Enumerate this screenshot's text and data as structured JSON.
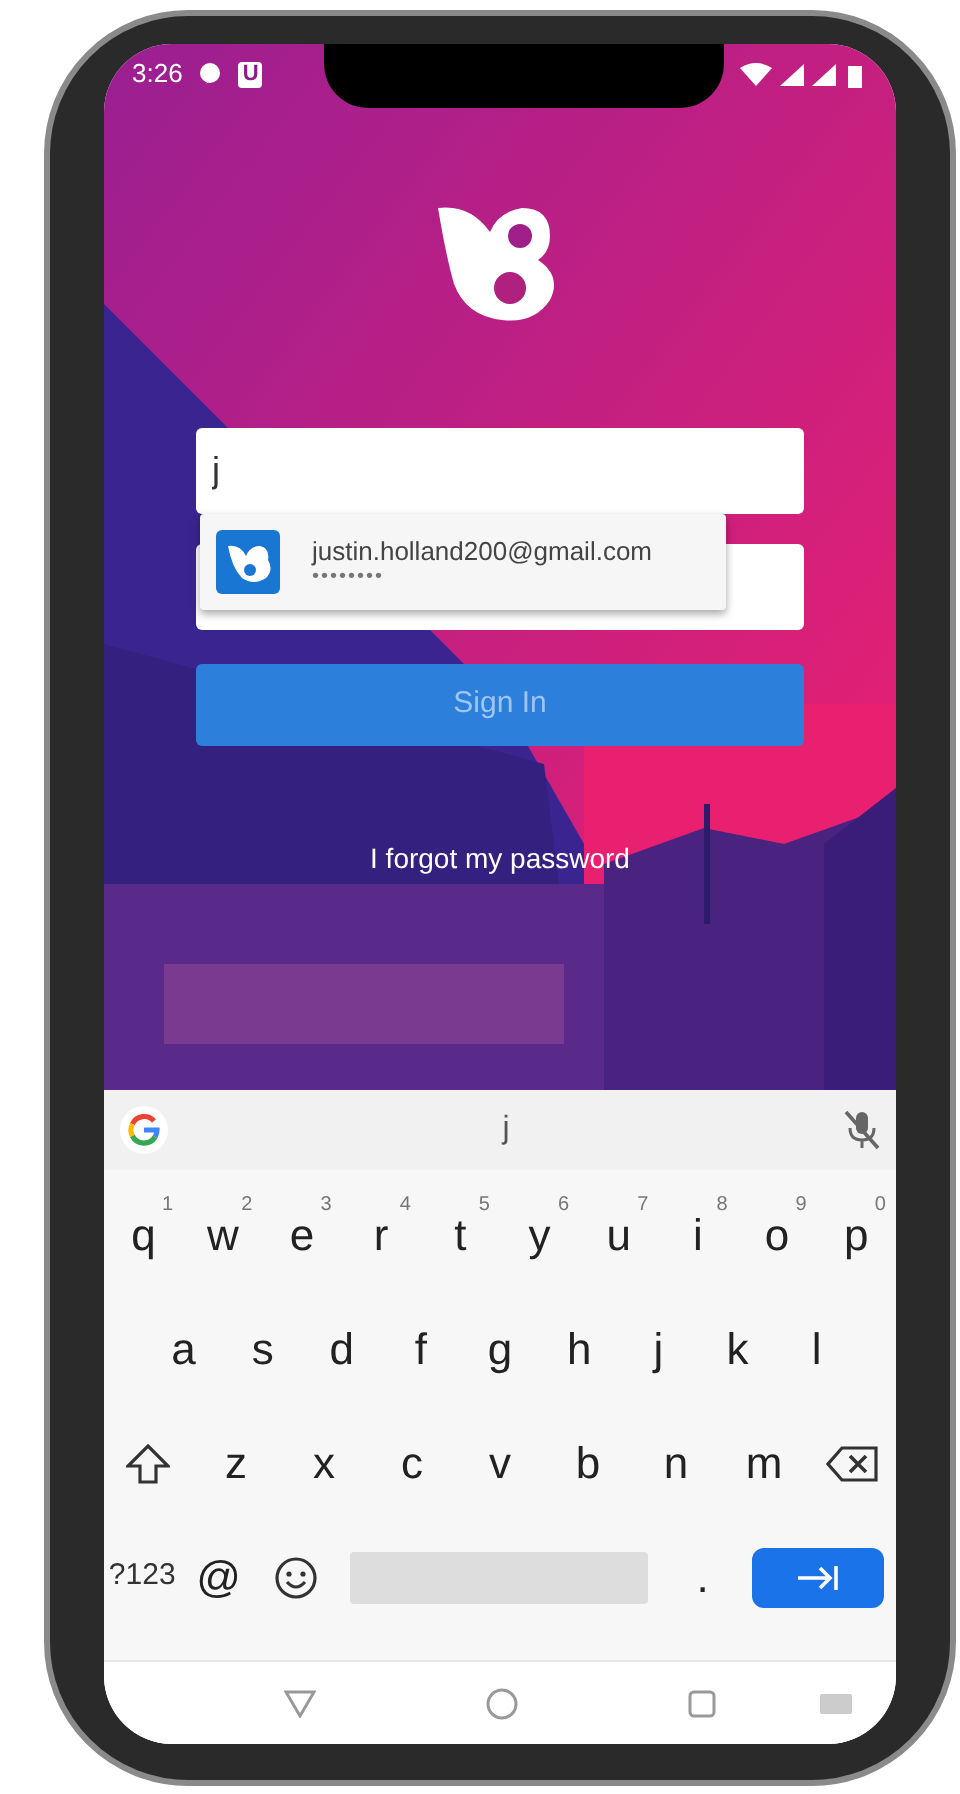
{
  "status_bar": {
    "time": "3:26",
    "app_badge": "U"
  },
  "login": {
    "username_field": {
      "value": "j"
    },
    "autofill_suggestion": {
      "account": "justin.holland200@gmail.com",
      "password_mask": "••••••••"
    },
    "sign_in_button": {
      "label": "Sign In"
    },
    "forgot_link": "I forgot my password"
  },
  "keyboard": {
    "suggestion": "j",
    "rows": [
      [
        {
          "kind": "char",
          "key": "q",
          "hint": "1"
        },
        {
          "kind": "char",
          "key": "w",
          "hint": "2"
        },
        {
          "kind": "char",
          "key": "e",
          "hint": "3"
        },
        {
          "kind": "char",
          "key": "r",
          "hint": "4"
        },
        {
          "kind": "char",
          "key": "t",
          "hint": "5"
        },
        {
          "kind": "char",
          "key": "y",
          "hint": "6"
        },
        {
          "kind": "char",
          "key": "u",
          "hint": "7"
        },
        {
          "kind": "char",
          "key": "i",
          "hint": "8"
        },
        {
          "kind": "char",
          "key": "o",
          "hint": "9"
        },
        {
          "kind": "char",
          "key": "p",
          "hint": "0"
        }
      ],
      [
        {
          "kind": "char",
          "key": "a"
        },
        {
          "kind": "char",
          "key": "s"
        },
        {
          "kind": "char",
          "key": "d"
        },
        {
          "kind": "char",
          "key": "f"
        },
        {
          "kind": "char",
          "key": "g"
        },
        {
          "kind": "char",
          "key": "h"
        },
        {
          "kind": "char",
          "key": "j"
        },
        {
          "kind": "char",
          "key": "k"
        },
        {
          "kind": "char",
          "key": "l"
        }
      ],
      [
        {
          "kind": "shift"
        },
        {
          "kind": "char",
          "key": "z"
        },
        {
          "kind": "char",
          "key": "x"
        },
        {
          "kind": "char",
          "key": "c"
        },
        {
          "kind": "char",
          "key": "v"
        },
        {
          "kind": "char",
          "key": "b"
        },
        {
          "kind": "char",
          "key": "n"
        },
        {
          "kind": "char",
          "key": "m"
        },
        {
          "kind": "backspace"
        }
      ],
      [
        {
          "kind": "symbols",
          "key": "?123"
        },
        {
          "kind": "char",
          "key": "@"
        },
        {
          "kind": "emoji"
        },
        {
          "kind": "space"
        },
        {
          "kind": "char",
          "key": "."
        },
        {
          "kind": "enter"
        }
      ]
    ]
  }
}
